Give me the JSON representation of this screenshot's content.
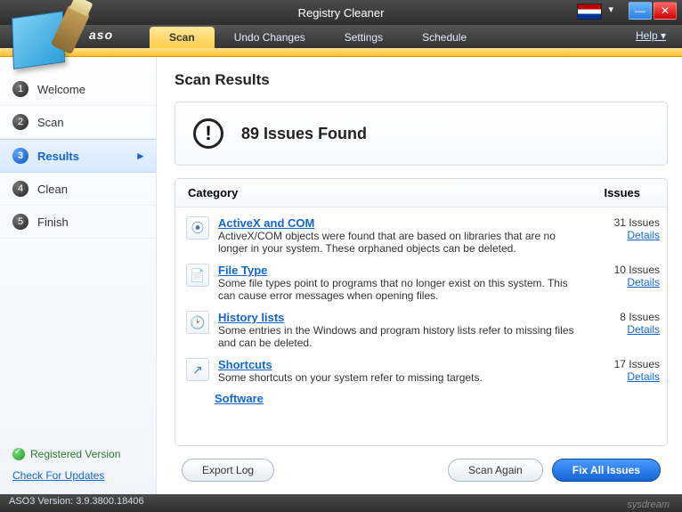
{
  "window": {
    "title": "Registry Cleaner"
  },
  "brand": "aso",
  "help_label": "Help",
  "tabs": [
    {
      "label": "Scan",
      "active": true
    },
    {
      "label": "Undo Changes",
      "active": false
    },
    {
      "label": "Settings",
      "active": false
    },
    {
      "label": "Schedule",
      "active": false
    }
  ],
  "steps": [
    {
      "num": "1",
      "label": "Welcome",
      "active": false
    },
    {
      "num": "2",
      "label": "Scan",
      "active": false
    },
    {
      "num": "3",
      "label": "Results",
      "active": true
    },
    {
      "num": "4",
      "label": "Clean",
      "active": false
    },
    {
      "num": "5",
      "label": "Finish",
      "active": false
    }
  ],
  "registered_label": "Registered Version",
  "check_updates_label": "Check For Updates",
  "page_title": "Scan Results",
  "summary": "89 Issues Found",
  "columns": {
    "category": "Category",
    "issues": "Issues"
  },
  "details_label": "Details",
  "categories": [
    {
      "icon": "⦿",
      "name": "ActiveX and COM",
      "desc": "ActiveX/COM objects were found that are based on libraries that are no longer in your system. These orphaned objects can be deleted.",
      "count": "31 Issues"
    },
    {
      "icon": "📄",
      "name": "File Type",
      "desc": "Some file types point to programs that no longer exist on this system. This can cause error messages when opening files.",
      "count": "10 Issues"
    },
    {
      "icon": "🕑",
      "name": "History lists",
      "desc": "Some entries in the Windows and program history lists refer to missing files and can be deleted.",
      "count": "8 Issues"
    },
    {
      "icon": "↗",
      "name": "Shortcuts",
      "desc": "Some shortcuts on your system refer to missing targets.",
      "count": "17 Issues"
    }
  ],
  "software_link": "Software",
  "buttons": {
    "export": "Export Log",
    "scan_again": "Scan Again",
    "fix_all": "Fix All Issues"
  },
  "status": "ASO3 Version: 3.9.3800.18406",
  "watermark": "sysdream"
}
